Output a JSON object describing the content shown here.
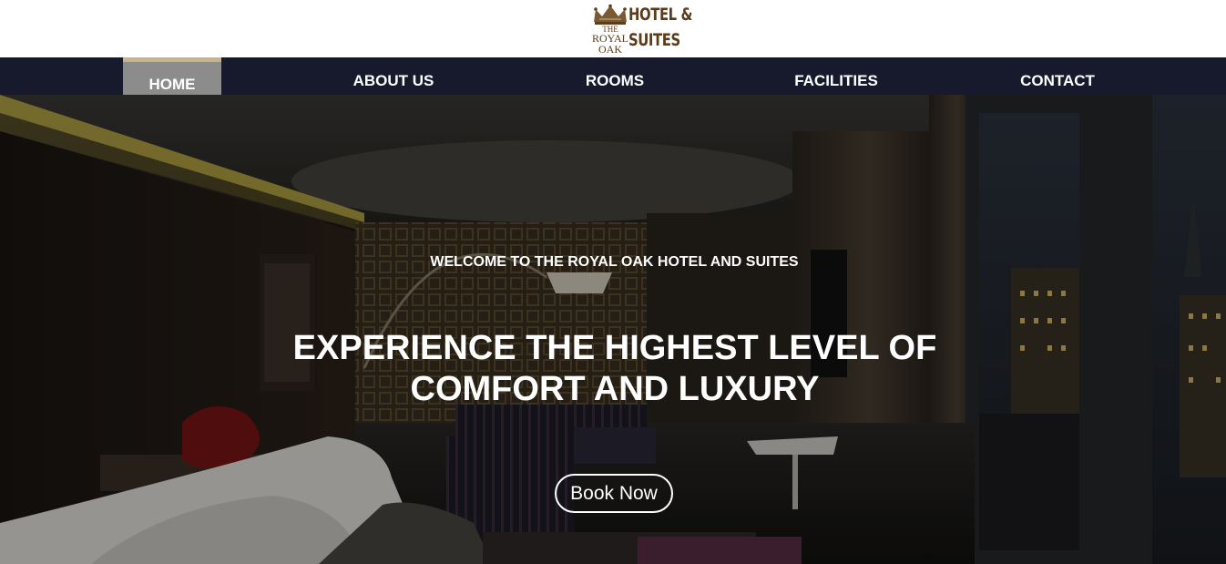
{
  "logo": {
    "the": "THE",
    "royal": "ROYAL",
    "oak": "OAK",
    "line1": "HOTEL &",
    "line2": "SUITES",
    "icon": "crown-icon",
    "color": "#5a3b1a"
  },
  "nav": {
    "items": [
      {
        "label": "HOME",
        "active": true
      },
      {
        "label": "ABOUT US",
        "active": false
      },
      {
        "label": "ROOMS",
        "active": false
      },
      {
        "label": "FACILITIES",
        "active": false
      },
      {
        "label": "CONTACT",
        "active": false
      }
    ],
    "background": "#161a2c",
    "active_background": "#8c8c8c",
    "active_accent": "#c9b38a"
  },
  "hero": {
    "welcome": "WELCOME TO THE ROYAL OAK HOTEL AND SUITES",
    "title": "EXPERIENCE THE HIGHEST LEVEL OF COMFORT AND LUXURY",
    "cta": "Book Now"
  }
}
